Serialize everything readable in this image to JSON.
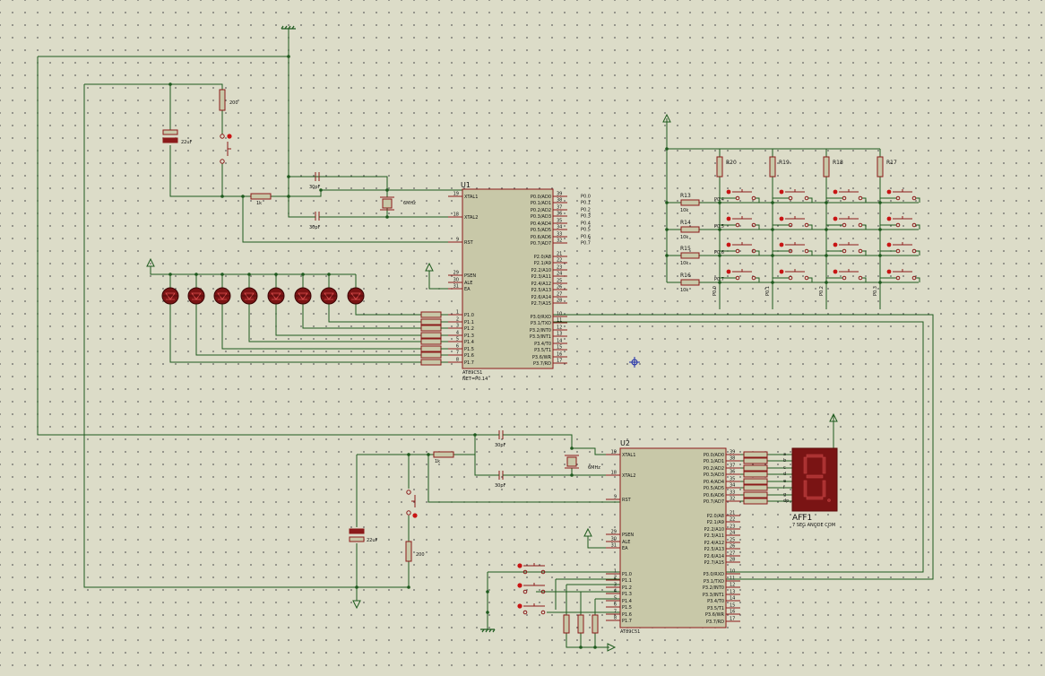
{
  "u1": {
    "ref": "U1",
    "part": "AT89C51",
    "net": "NET=P0.14",
    "left_pins": [
      {
        "num": "19",
        "name": "XTAL1"
      },
      {
        "num": "18",
        "name": "XTAL2"
      },
      {
        "num": "9",
        "name": "RST"
      },
      {
        "num": "29",
        "name": "PSEN"
      },
      {
        "num": "30",
        "name": "ALE"
      },
      {
        "num": "31",
        "name": "EA"
      },
      {
        "num": "1",
        "name": "P1.0"
      },
      {
        "num": "2",
        "name": "P1.1"
      },
      {
        "num": "3",
        "name": "P1.2"
      },
      {
        "num": "4",
        "name": "P1.3"
      },
      {
        "num": "5",
        "name": "P1.4"
      },
      {
        "num": "6",
        "name": "P1.5"
      },
      {
        "num": "7",
        "name": "P1.6"
      },
      {
        "num": "8",
        "name": "P1.7"
      }
    ],
    "right_pins": [
      {
        "num": "39",
        "name": "P0.0/AD0"
      },
      {
        "num": "38",
        "name": "P0.1/AD1"
      },
      {
        "num": "37",
        "name": "P0.2/AD2"
      },
      {
        "num": "36",
        "name": "P0.3/AD3"
      },
      {
        "num": "35",
        "name": "P0.4/AD4"
      },
      {
        "num": "34",
        "name": "P0.5/AD5"
      },
      {
        "num": "33",
        "name": "P0.6/AD6"
      },
      {
        "num": "32",
        "name": "P0.7/AD7"
      },
      {
        "num": "21",
        "name": "P2.0/A8"
      },
      {
        "num": "22",
        "name": "P2.1/A9"
      },
      {
        "num": "23",
        "name": "P2.2/A10"
      },
      {
        "num": "24",
        "name": "P2.3/A11"
      },
      {
        "num": "25",
        "name": "P2.4/A12"
      },
      {
        "num": "26",
        "name": "P2.5/A13"
      },
      {
        "num": "27",
        "name": "P2.6/A14"
      },
      {
        "num": "28",
        "name": "P2.7/A15"
      },
      {
        "num": "10",
        "name": "P3.0/RXD"
      },
      {
        "num": "11",
        "name": "P3.1/TXD"
      },
      {
        "num": "12",
        "name": "P3.2/INT0"
      },
      {
        "num": "13",
        "name": "P3.3/INT1"
      },
      {
        "num": "14",
        "name": "P3.4/T0"
      },
      {
        "num": "15",
        "name": "P3.5/T1"
      },
      {
        "num": "16",
        "name": "P3.6/WR"
      },
      {
        "num": "17",
        "name": "P3.7/RD"
      }
    ],
    "net_labels": [
      "P0.0",
      "P0.1",
      "P0.2",
      "P0.3",
      "P0.4",
      "P0.5",
      "P0.6",
      "P0.7"
    ]
  },
  "u2": {
    "ref": "U2",
    "part": "AT89C51"
  },
  "u1_circuit": {
    "r_reset": "200",
    "c_reset": "22uF",
    "r_1k": "1k",
    "c1": "30pF",
    "c2": "30pF",
    "crystal": "6MHz"
  },
  "u2_circuit": {
    "r_reset": "200",
    "c_reset": "22uF",
    "r_1k": "1k",
    "c1": "30pF",
    "c2": "30pF",
    "crystal": "6MHz"
  },
  "keypad": {
    "col_resistors": [
      "R20",
      "R19",
      "R18",
      "R17"
    ],
    "row_resistors": [
      "R13",
      "R14",
      "R15",
      "R16"
    ],
    "value": "10k",
    "row_nets": [
      "P0.4",
      "P0.5",
      "P0.6",
      "P0.7"
    ],
    "col_nets": [
      "P0.0",
      "P0.1",
      "P0.2",
      "P0.3"
    ]
  },
  "display": {
    "ref": "AFF1",
    "desc": "7 SEG ANODE COM",
    "segments": [
      "a",
      "b",
      "c",
      "d",
      "e",
      "f",
      "g",
      "dp"
    ]
  }
}
